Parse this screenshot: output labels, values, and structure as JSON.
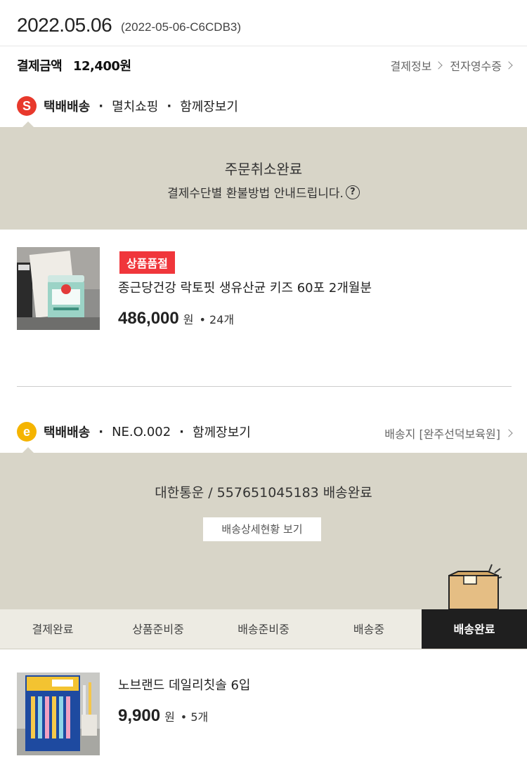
{
  "order": {
    "date": "2022.05.06",
    "code": "(2022-05-06-C6CDB3)"
  },
  "payment": {
    "label": "결제금액",
    "amount": "12,400원",
    "info_link": "결제정보",
    "receipt_link": "전자영수증"
  },
  "shipments": [
    {
      "badge": "S",
      "badge_color": "#e8392c",
      "method": "택배배송",
      "seller": "멸치쇼핑",
      "together": "함께장보기",
      "status_title": "주문취소완료",
      "status_sub": "결제수단별 환불방법 안내드립니다.",
      "help_icon": "?",
      "product": {
        "soldout_label": "상품품절",
        "name": "종근당건강 락토핏 생유산균 키즈 60포 2개월분",
        "price": "486,000",
        "won": "원",
        "qty": "• 24개"
      }
    },
    {
      "badge": "e",
      "badge_color": "#f5b400",
      "method": "택배배송",
      "seller": "NE.O.002",
      "together": "함께장보기",
      "destination": "배송지 [완주선덕보육원]",
      "status_title": "대한통운 / 557651045183 배송완료",
      "detail_button": "배송상세현황 보기",
      "steps": [
        "결제완료",
        "상품준비중",
        "배송준비중",
        "배송중",
        "배송완료"
      ],
      "active_step": 4,
      "product": {
        "name": "노브랜드 데일리칫솔 6입",
        "price": "9,900",
        "won": "원",
        "qty": "• 5개"
      }
    }
  ],
  "colors": {
    "panel_bg": "#d8d5c8",
    "soldout_red": "#f0363b",
    "active_step_bg": "#1f1f1f"
  }
}
